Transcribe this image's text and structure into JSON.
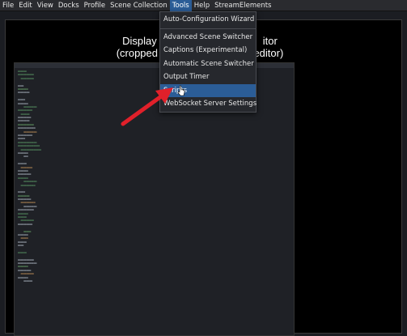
{
  "menubar": {
    "items": [
      {
        "label": "File"
      },
      {
        "label": "Edit"
      },
      {
        "label": "View"
      },
      {
        "label": "Docks"
      },
      {
        "label": "Profile"
      },
      {
        "label": "Scene Collection"
      },
      {
        "label": "Tools"
      },
      {
        "label": "Help"
      },
      {
        "label": "StreamElements"
      }
    ],
    "active": "Tools"
  },
  "preview": {
    "title_line1": "Display C",
    "title_line1_end": "itor",
    "title_line2": "(cropped to",
    "title_line2_end": "editor)"
  },
  "tools_menu": {
    "items": [
      {
        "label": "Auto-Configuration Wizard"
      },
      {
        "label": "Advanced Scene Switcher"
      },
      {
        "label": "Captions (Experimental)"
      },
      {
        "label": "Automatic Scene Switcher"
      },
      {
        "label": "Output Timer"
      },
      {
        "label": "Scripts"
      },
      {
        "label": "WebSocket Server Settings"
      }
    ],
    "highlighted": "Scripts"
  },
  "colors": {
    "accent": "#2b5d97",
    "arrow": "#e0202a",
    "menubar_bg": "#2a2b2f",
    "preview_bg": "#000000"
  }
}
